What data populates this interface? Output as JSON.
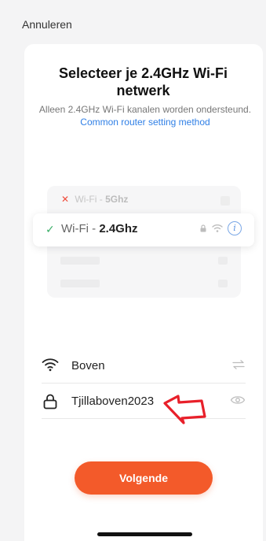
{
  "header": {
    "cancel_label": "Annuleren"
  },
  "title": "Selecteer je 2.4GHz Wi-Fi netwerk",
  "subtitle": {
    "text": "Alleen 2.4GHz Wi-Fi kanalen worden ondersteund.",
    "link": "Common router setting method"
  },
  "illustration": {
    "bad_option": {
      "prefix": "Wi-Fi - ",
      "band": "5Ghz"
    },
    "good_option": {
      "prefix": "Wi-Fi - ",
      "band": "2.4Ghz"
    }
  },
  "form": {
    "network_name": "Boven",
    "password": "Tjillaboven2023"
  },
  "next_button_label": "Volgende",
  "colors": {
    "accent": "#f35a2a",
    "link": "#2f7fe6",
    "success": "#3aae67",
    "error": "#ef4d3c",
    "annotation_arrow": "#e8202a"
  }
}
